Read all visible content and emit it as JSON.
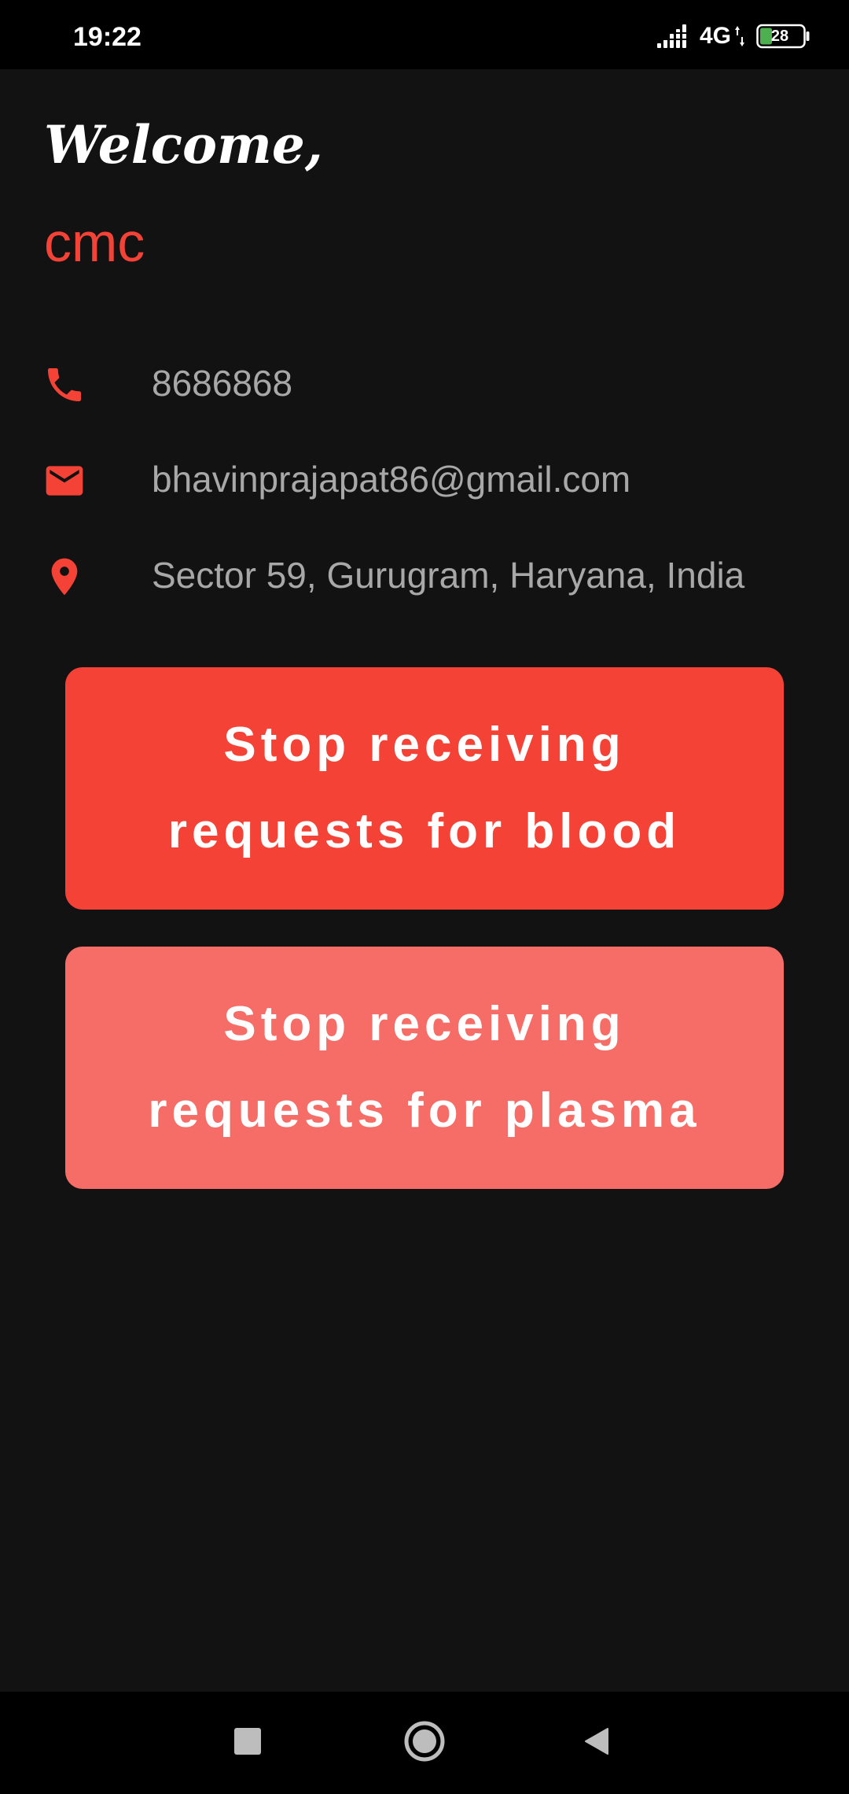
{
  "status_bar": {
    "time": "19:22",
    "network": "4G",
    "battery": "28",
    "icons": [
      "signal-icon",
      "battery-icon"
    ]
  },
  "profile": {
    "greeting": "Welcome,",
    "name": "cmc",
    "phone": "8686868",
    "email": "bhavinprajapat86@gmail.com",
    "location": "Sector 59, Gurugram, Haryana, India",
    "icons": [
      "phone-icon",
      "email-icon",
      "location-pin-icon"
    ]
  },
  "actions": {
    "stop_blood_label": "Stop receiving requests for blood",
    "stop_plasma_label": "Stop receiving requests for plasma"
  },
  "nav_bar": {
    "icons": [
      "recents-square-icon",
      "home-circle-icon",
      "back-triangle-icon"
    ]
  },
  "colors": {
    "accent": "#f44336",
    "accent_light": "#f66c66",
    "background": "#121212",
    "secondary_text": "#a8a8a8",
    "bars": "#000000"
  }
}
